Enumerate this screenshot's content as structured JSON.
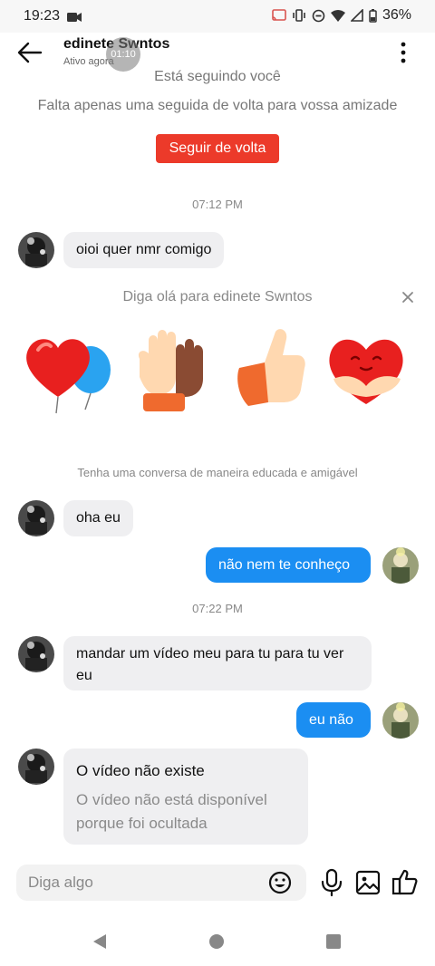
{
  "status_bar": {
    "time": "19:23",
    "battery": "36%"
  },
  "header": {
    "name": "edinete Swntos",
    "status": "Ativo agora",
    "timer": "01:10"
  },
  "follow_banner": {
    "line1": "Está seguindo você",
    "line2": "Falta apenas uma seguida de volta para vossa amizade",
    "button": "Seguir de volta"
  },
  "messages": {
    "ts1": "07:12 PM",
    "m1": "oioi quer nmr comigo",
    "say_hello": "Diga olá para edinete Swntos",
    "polite_notice": "Tenha uma conversa de maneira educada e amigável",
    "m2": "oha eu",
    "m3": "não nem te conheço",
    "ts2": "07:22 PM",
    "m4_line1": "mandar um vídeo meu para tu para tu ver",
    "m4_line2": "eu",
    "m5": "eu não",
    "m6_title": "O vídeo não existe",
    "m6_line1": "O vídeo não está disponível",
    "m6_line2": "porque foi ocultada"
  },
  "stickers": [
    "heart-balloons",
    "high-five-hands",
    "thumbs-up",
    "hugging-heart"
  ],
  "composer": {
    "placeholder": "Diga algo"
  },
  "colors": {
    "follow_button": "#ec3a2a",
    "outgoing_bubble": "#1b8ef2",
    "incoming_bubble": "#efeff1"
  }
}
